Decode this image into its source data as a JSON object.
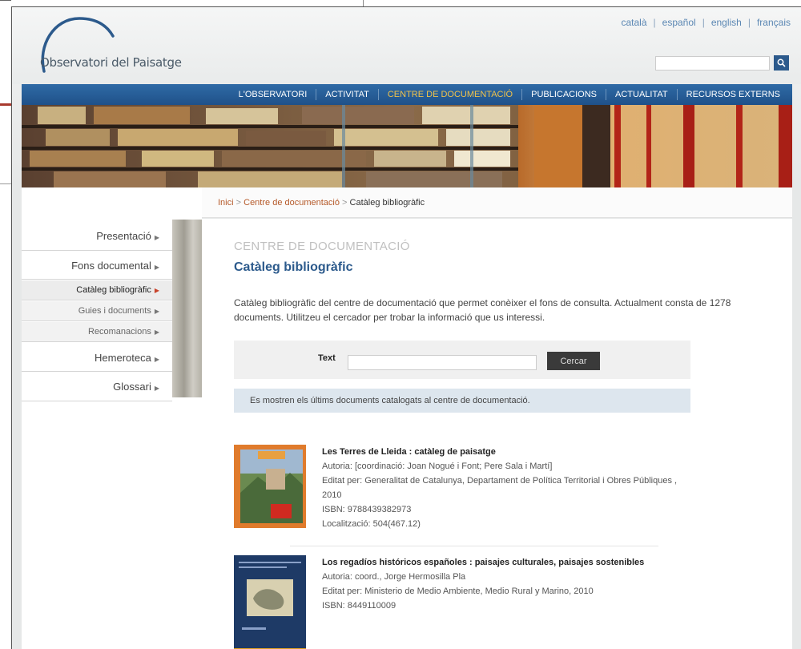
{
  "site": {
    "logo_text": "Observatori del Paisatge"
  },
  "languages": [
    "català",
    "español",
    "english",
    "français"
  ],
  "nav": {
    "items": [
      "L'OBSERVATORI",
      "ACTIVITAT",
      "CENTRE DE DOCUMENTACIÓ",
      "PUBLICACIONS",
      "ACTUALITAT",
      "RECURSOS EXTERNS"
    ],
    "active_index": 2
  },
  "breadcrumb": {
    "home": "Inici",
    "section": "Centre de documentació",
    "current": "Catàleg bibliogràfic",
    "separator": ">"
  },
  "sidebar": [
    {
      "label": "Presentació",
      "level": 0
    },
    {
      "label": "Fons documental",
      "level": 0
    },
    {
      "label": "Catàleg bibliogràfic",
      "level": 1,
      "current": true
    },
    {
      "label": "Guies i documents",
      "level": 1
    },
    {
      "label": "Recomanacions",
      "level": 1
    },
    {
      "label": "Hemeroteca",
      "level": 0
    },
    {
      "label": "Glossari",
      "level": 0
    }
  ],
  "content": {
    "kicker": "CENTRE DE DOCUMENTACIÓ",
    "title": "Catàleg bibliogràfic",
    "intro": "Catàleg bibliogràfic del centre de documentació que permet conèixer el fons de consulta. Actualment consta de 1278 documents. Utilitzeu el cercador per trobar la informació que us interessi.",
    "search_label": "Text",
    "search_value": "",
    "search_button": "Cercar",
    "notice": "Es mostren els últims documents catalogats al centre de documentació."
  },
  "books": [
    {
      "title": "Les Terres de Lleida : catàleg de paisatge",
      "lines": [
        "Autoria: [coordinació: Joan Nogué i Font; Pere Sala i Martí]",
        "Editat per: Generalitat de Catalunya, Departament de Política Territorial i Obres Públiques , 2010",
        "ISBN: 9788439382973",
        "Localització: 504(467.12)"
      ]
    },
    {
      "title": "Los regadíos históricos españoles : paisajes culturales, paisajes sostenibles",
      "lines": [
        "Autoria: coord., Jorge Hermosilla Pla",
        "Editat per: Ministerio de Medio Ambiente, Medio Rural y Marino, 2010",
        "ISBN: 8449110009"
      ]
    }
  ],
  "colors": {
    "accent_blue": "#2c5a8c",
    "nav_active": "#f0c24a",
    "link_orange": "#b55a2a"
  }
}
